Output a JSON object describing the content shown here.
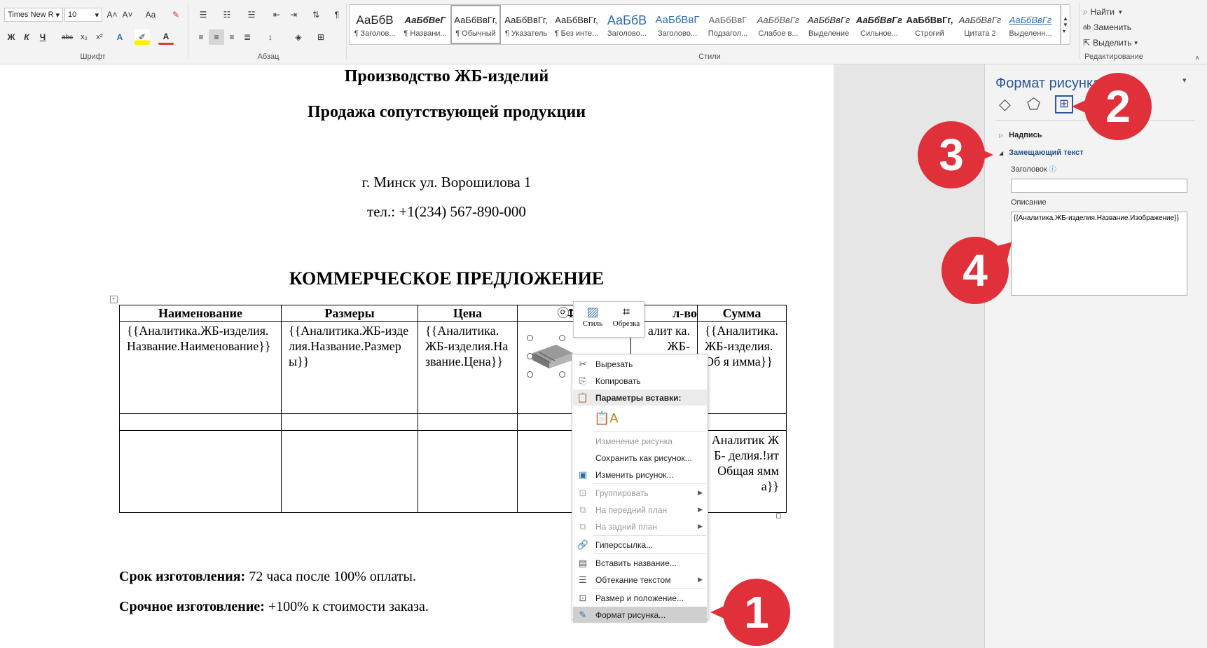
{
  "ribbon": {
    "font_name": "Times New R",
    "font_size": "10",
    "group_font": "Шрифт",
    "group_paragraph": "Абзац",
    "group_styles": "Стили",
    "group_editing": "Редактирование",
    "bold": "Ж",
    "italic": "К",
    "underline": "Ч",
    "strike": "abc",
    "sub": "x₂",
    "sup": "x²",
    "grow": "A˄",
    "shrink": "A˅",
    "case": "Aa",
    "pilcrow": "¶",
    "find": "Найти",
    "replace": "Заменить",
    "select": "Выделить",
    "styles": [
      {
        "preview": "АаБбВ",
        "name": "¶ Заголов..."
      },
      {
        "preview": "АаБбВеГ",
        "name": "¶ Названи..."
      },
      {
        "preview": "АаБбВвГг,",
        "name": "¶ Обычный"
      },
      {
        "preview": "АаБбВвГг,",
        "name": "¶ Указатель"
      },
      {
        "preview": "АаБбВвГг,",
        "name": "¶ Без инте..."
      },
      {
        "preview": "АаБбВ",
        "name": "Заголово..."
      },
      {
        "preview": "АаБбВвГ",
        "name": "Заголово..."
      },
      {
        "preview": "АаБбВвГ",
        "name": "Подзагол..."
      },
      {
        "preview": "АаБбВвГг",
        "name": "Слабое в..."
      },
      {
        "preview": "АаБбВвГг",
        "name": "Выделение"
      },
      {
        "preview": "АаБбВвГг",
        "name": "Сильное..."
      },
      {
        "preview": "АаБбВвГг,",
        "name": "Строгий"
      },
      {
        "preview": "АаБбВвГг",
        "name": "Цитата 2"
      },
      {
        "preview": "АаБбВвГг",
        "name": "Выделенн..."
      }
    ]
  },
  "document": {
    "title1": "Производство ЖБ-изделий",
    "title2": "Продажа сопутствующей продукции",
    "address": "г. Минск ул. Ворошилова 1",
    "phone": "тел.:  +1(234) 567-890-000",
    "heading": "КОММЕРЧЕСКОЕ ПРЕДЛОЖЕНИЕ",
    "table_headers": [
      "Наименование",
      "Размеры",
      "Цена",
      "Фо",
      "л-во",
      "Сумма"
    ],
    "row1": [
      "{{Аналитика.ЖБ-изделия.Название.Наименование}}",
      "{{Аналитика.ЖБ-изделия.Название.Размеры}}",
      "{{Аналитика.ЖБ-изделия.Название.Цена}}",
      "",
      "алит ка.ЖБ-",
      "{{Аналитика.ЖБ-изделия.Об я имма}}"
    ],
    "row3_sum": "Аналитик ЖБ- делия.!ит Общая ямма}}",
    "term_label": "Срок изготовления:",
    "term_value": " 72 часа после 100% оплаты.",
    "urgent_label": "Срочное изготовление:",
    "urgent_value": " +100% к стоимости заказа."
  },
  "mini_toolbar": {
    "style": "Стиль",
    "crop": "Обрезка"
  },
  "context_menu": {
    "cut": "Вырезать",
    "copy": "Копировать",
    "paste_options": "Параметры вставки:",
    "change_picture_dis": "Изменение рисунка",
    "save_as_picture": "Сохранить как рисунок...",
    "change_picture": "Изменить рисунок...",
    "group": "Группировать",
    "bring_forward": "На передний план",
    "send_backward": "На задний план",
    "hyperlink": "Гиперссылка...",
    "insert_caption": "Вставить название...",
    "wrap_text": "Обтекание текстом",
    "size_position": "Размер и положение...",
    "format_picture": "Формат рисунка..."
  },
  "pane": {
    "title": "Формат рисунка",
    "section_caption": "Надпись",
    "section_alt": "Замещающий текст",
    "field_title_label": "Заголовок",
    "field_title_value": "",
    "field_desc_label": "Описание",
    "field_desc_value": "{{Аналитика.ЖБ-изделия.Название.Изображение}}"
  },
  "badges": [
    "1",
    "2",
    "3",
    "4"
  ],
  "colors": {
    "badge": "#e0303a",
    "pane_link": "#1f4e8c",
    "ribbon_bg": "#f3f3f3"
  }
}
